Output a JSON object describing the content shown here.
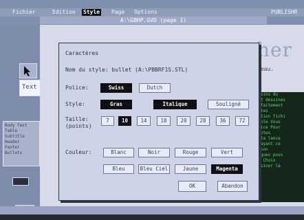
{
  "menu": {
    "items": [
      "Fichier",
      "Edition",
      "Style",
      "Page",
      "Options"
    ],
    "selected": "Style",
    "app": "PUBLISHR"
  },
  "window_title": "A:\\GBHP.GVD (page 1)",
  "document": {
    "heading": "her",
    "subtext": "reau.",
    "dark_lines": [
      "dessins du",
      "sont dessines",
      "parfaitement",
      "pentes",
      "gestion fichi",
      "simple Vous",
      "police Pour",
      "pilotes",
      "de la lance",
      "le ayant ce",
      "de son",
      "longues pous",
      "ton Choix",
      "dessiner la"
    ]
  },
  "left_panel": {
    "text_tool": "Text",
    "style_list": [
      "Body Text",
      "Table",
      "Subtitle",
      "Header",
      "Footer",
      "Bullets"
    ]
  },
  "dialog": {
    "title": "Caractères",
    "style_name_label": "Nom du style: bullet (A:\\PBBRF1S.STL)",
    "police_label": "Police:",
    "police_options": [
      "Swiss",
      "Dutch"
    ],
    "police_selected": "Swiss",
    "style_label": "Style:",
    "style_options": [
      "Gras",
      "Italique",
      "Souligné"
    ],
    "style_selected": [
      "Gras",
      "Italique"
    ],
    "taille_label": "Taille:",
    "taille_sub": "(points)",
    "sizes": [
      "7",
      "10",
      "14",
      "18",
      "20",
      "28",
      "36",
      "72"
    ],
    "size_selected": "10",
    "couleur_label": "Couleur:",
    "colors": [
      "Blanc",
      "Noir",
      "Rouge",
      "Vert",
      "Bleu",
      "Bleu Ciel",
      "Jaune",
      "Magenta"
    ],
    "color_selected": "Magenta",
    "ok": "OK",
    "cancel": "Abandon"
  }
}
